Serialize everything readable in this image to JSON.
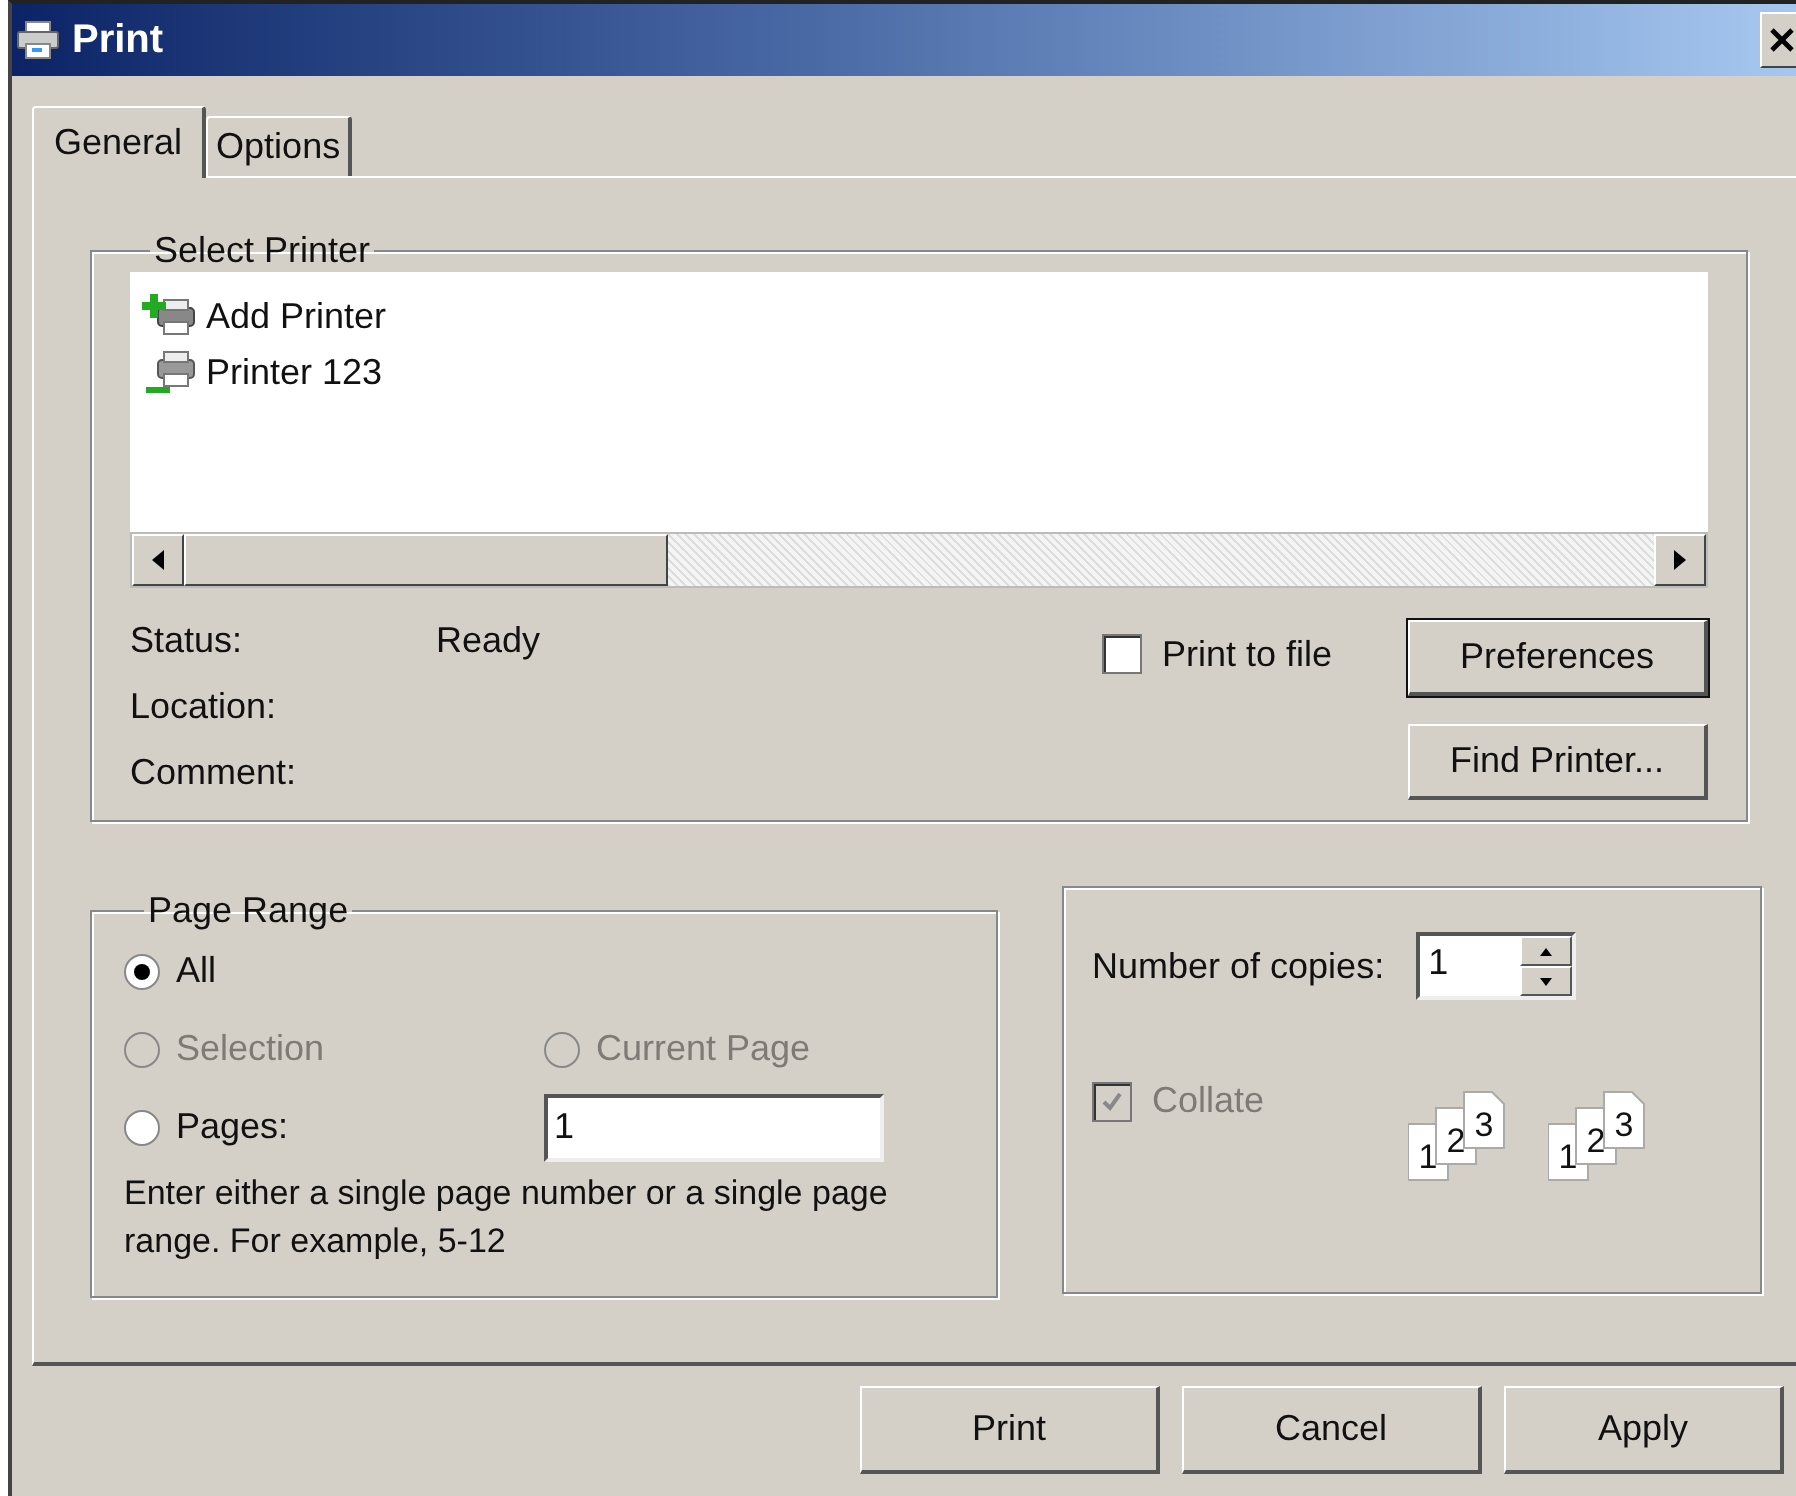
{
  "window": {
    "title": "Print"
  },
  "tabs": [
    {
      "label": "General",
      "selected": true
    },
    {
      "label": "Options",
      "selected": false
    }
  ],
  "select_printer": {
    "title": "Select Printer",
    "printers": [
      {
        "name": "Add Printer",
        "kind": "add"
      },
      {
        "name": "Printer 123",
        "kind": "printer"
      }
    ],
    "info": [
      {
        "label": "Status:",
        "value": "Ready"
      },
      {
        "label": "Location:"
      },
      {
        "label": "Comment:"
      }
    ],
    "print_to_file": {
      "label": "Print to file",
      "checked": false
    },
    "buttons": [
      {
        "label": "Preferences",
        "default": true
      },
      {
        "label": "Find Printer...",
        "default": false
      }
    ]
  },
  "page_range": {
    "title": "Page Range",
    "rows": [
      [
        {
          "label": "All",
          "selected": true,
          "disabled": false
        }
      ],
      [
        {
          "label": "Selection",
          "selected": false,
          "disabled": true
        },
        {
          "label": "Current Page",
          "selected": false,
          "disabled": true
        }
      ],
      [
        {
          "label": "Pages:",
          "selected": false,
          "disabled": false
        }
      ]
    ],
    "pages_value": "1",
    "hint": "Enter either a single page number or a single page range.  For example, 5-12"
  },
  "copies": {
    "label": "Number of copies:",
    "value": "1",
    "collate": {
      "label": "Collate",
      "checked": true,
      "disabled": true
    },
    "collate_icons": [
      [
        "1",
        "2",
        "3"
      ],
      [
        "1",
        "2",
        "3"
      ]
    ]
  },
  "footer_buttons": [
    {
      "label": "Print"
    },
    {
      "label": "Cancel"
    },
    {
      "label": "Apply"
    }
  ]
}
